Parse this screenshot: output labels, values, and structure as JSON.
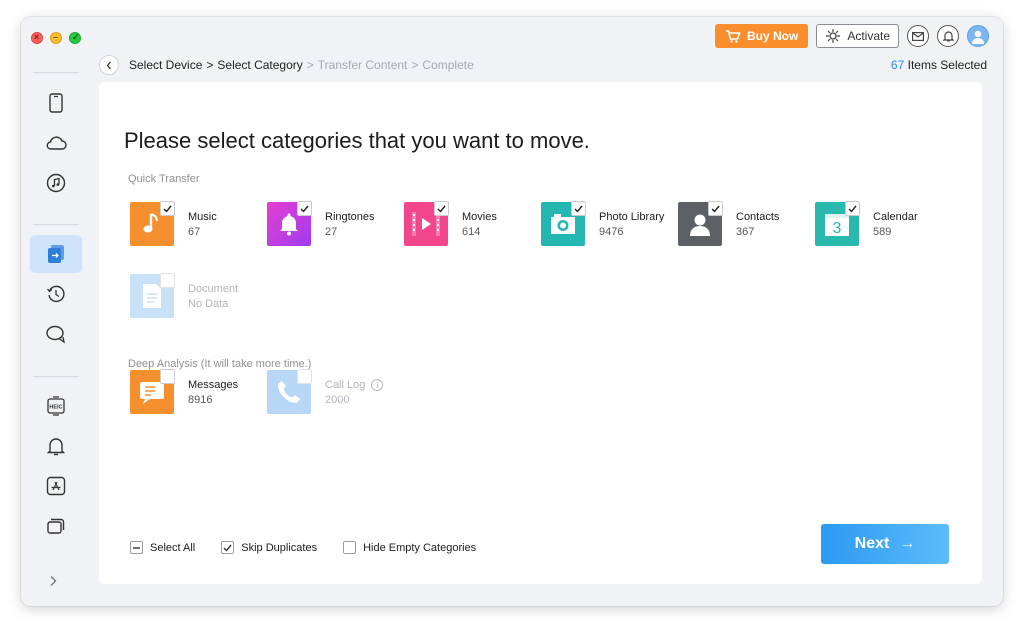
{
  "top": {
    "buy_label": "Buy Now",
    "activate_label": "Activate"
  },
  "breadcrumb": {
    "steps": [
      {
        "label": "Select Device",
        "state": "done"
      },
      {
        "label": "Select Category",
        "state": "current"
      },
      {
        "label": "Transfer Content",
        "state": "pending"
      },
      {
        "label": "Complete",
        "state": "pending"
      }
    ],
    "separator": ">",
    "items_count": "67",
    "items_label": "Items Selected"
  },
  "main": {
    "headline": "Please select categories that you want to move.",
    "quick_label": "Quick Transfer",
    "quick_items": [
      {
        "name": "Music",
        "count": "67",
        "icon": "music-icon",
        "color": "#f68f2e",
        "checked": true
      },
      {
        "name": "Ringtones",
        "count": "27",
        "icon": "bell-icon",
        "color": "#b640e7",
        "checked": true
      },
      {
        "name": "Movies",
        "count": "614",
        "icon": "film-icon",
        "color": "#f2468c",
        "checked": true
      },
      {
        "name": "Photo Library",
        "count": "9476",
        "icon": "camera-icon",
        "color": "#24b7b1",
        "checked": true
      },
      {
        "name": "Contacts",
        "count": "367",
        "icon": "contact-icon",
        "color": "#5c6066",
        "checked": true
      },
      {
        "name": "Calendar",
        "count": "589",
        "icon": "calendar-icon",
        "color": "#29b9ad",
        "checked": true
      }
    ],
    "document": {
      "name": "Document",
      "count": "No Data",
      "icon": "document-icon",
      "color": "#9ec9f2"
    },
    "deep_label": "Deep Analysis (It will take more time.)",
    "deep_items": [
      {
        "name": "Messages",
        "count": "8916",
        "icon": "message-icon",
        "color": "#f68f2e"
      },
      {
        "name": "Call Log",
        "count": "2000",
        "icon": "phone-icon",
        "color": "#7fb6ee"
      }
    ],
    "calendar_day": "3",
    "info_glyph": "i"
  },
  "options": {
    "select_all": "Select All",
    "skip_duplicates": "Skip Duplicates",
    "hide_empty": "Hide Empty Categories"
  },
  "next": {
    "label": "Next",
    "arrow": "→"
  },
  "sidebar_items": [
    "phone-icon",
    "cloud-icon",
    "music-note-icon",
    "transfer-icon",
    "history-icon",
    "chat-icon",
    "heic-icon",
    "bell-icon",
    "app-store-icon",
    "layers-icon",
    "chevron-right-icon"
  ]
}
